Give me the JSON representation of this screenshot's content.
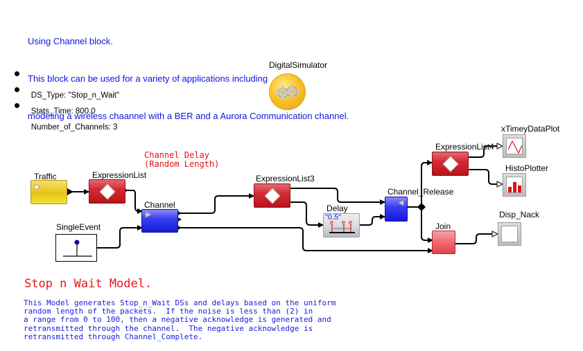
{
  "intro": {
    "lines": [
      "Using Channel block.",
      "This block can be used for a variety of applications including",
      "modeling a wireless chaannel with a BER and a Aurora Communication channel."
    ]
  },
  "parameters": [
    {
      "label": "DS_Type: \"Stop_n_Wait\""
    },
    {
      "label": "Stats_Time: 800.0"
    },
    {
      "label": "Number_of_Channels: 3"
    }
  ],
  "director": {
    "label": "DigitalSimulator",
    "icon": "gears-icon"
  },
  "annotations": {
    "channel_delay": "Channel Delay\n(Random Length)"
  },
  "blocks": {
    "traffic": {
      "label": "Traffic",
      "color": "#e8c21a"
    },
    "expression_list": {
      "label": "ExpressionList",
      "color": "#d52a34"
    },
    "channel": {
      "label": "Channel",
      "color": "#3a3ef0"
    },
    "single_event": {
      "label": "SingleEvent"
    },
    "expression_list3": {
      "label": "ExpressionList3",
      "color": "#d52a34"
    },
    "delay": {
      "label": "Delay",
      "value": "\"0.5\""
    },
    "channel_release": {
      "label": "Channel_Release",
      "color": "#3a3ef0"
    },
    "expression_list4": {
      "label": "ExpressionList4",
      "color": "#d52a34"
    },
    "join": {
      "label": "Join",
      "color": "#ef6f76"
    },
    "xtimey_data_plot": {
      "label": "xTimeyDataPlot",
      "icon": "sine-plot-icon"
    },
    "histo_plotter": {
      "label": "HistoPlotter",
      "icon": "histogram-icon"
    },
    "disp_nack": {
      "label": "Disp_Nack",
      "icon": "display-icon"
    }
  },
  "model": {
    "title": "Stop n Wait Model.",
    "description": "This Model generates Stop_n_Wait DSs and delays based on the uniform\nrandom length of the packets.  If the noise is less than (2) in\na range from 0 to 100, then a negative acknowledge is generated and\nretransmitted through the channel.  The negative acknowledge is\nretransmitted through Channel_Complete."
  },
  "colors": {
    "intro_text": "#0a14e6",
    "annotation_red": "#e01010",
    "description_blue": "#1a1adb"
  }
}
